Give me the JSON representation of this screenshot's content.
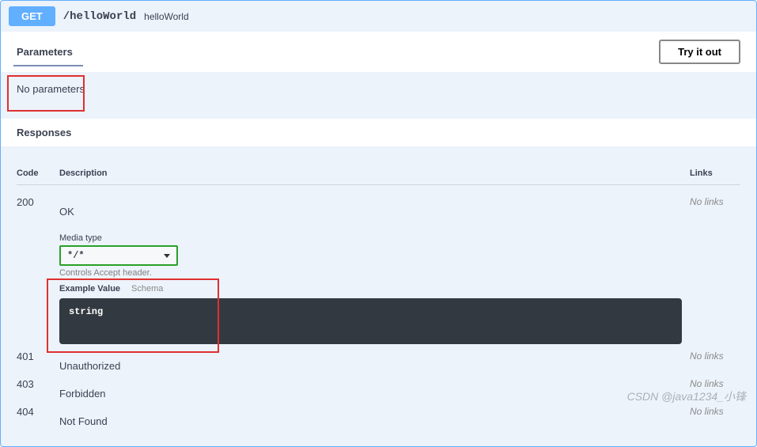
{
  "endpoint": {
    "method": "GET",
    "path": "/helloWorld",
    "summary": "helloWorld"
  },
  "parameters": {
    "heading": "Parameters",
    "try_label": "Try it out",
    "no_params": "No parameters"
  },
  "responses": {
    "heading": "Responses",
    "columns": {
      "code": "Code",
      "desc": "Description",
      "links": "Links"
    },
    "rows": [
      {
        "code": "200",
        "desc": "OK",
        "media_label": "Media type",
        "media_value": "*/*",
        "accept_hint": "Controls Accept header.",
        "tabs": {
          "example": "Example Value",
          "schema": "Schema"
        },
        "example_body": "string",
        "links": "No links",
        "has_detail": true
      },
      {
        "code": "401",
        "desc": "Unauthorized",
        "links": "No links",
        "has_detail": false
      },
      {
        "code": "403",
        "desc": "Forbidden",
        "links": "No links",
        "has_detail": false
      },
      {
        "code": "404",
        "desc": "Not Found",
        "links": "No links",
        "has_detail": false
      }
    ]
  },
  "watermark": "CSDN @java1234_小锋"
}
